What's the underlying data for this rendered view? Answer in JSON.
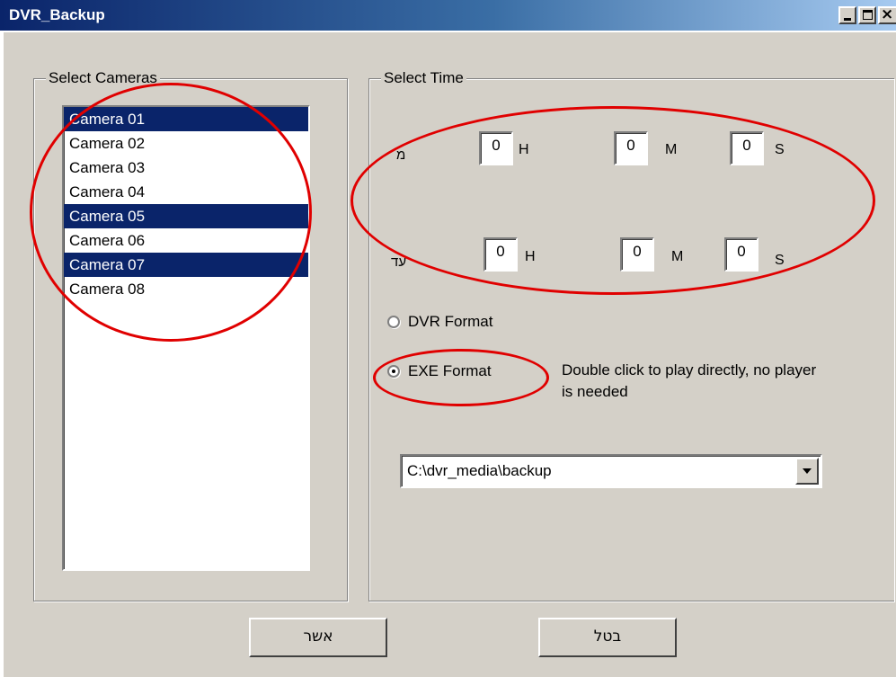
{
  "window": {
    "title": "DVR_Backup",
    "minimize_glyph": "",
    "maximize_glyph": "",
    "close_glyph": "×"
  },
  "cameras": {
    "legend": "Select Cameras",
    "items": [
      {
        "label": "Camera 01",
        "selected": true
      },
      {
        "label": "Camera 02",
        "selected": false
      },
      {
        "label": "Camera 03",
        "selected": false
      },
      {
        "label": "Camera 04",
        "selected": false
      },
      {
        "label": "Camera 05",
        "selected": true
      },
      {
        "label": "Camera 06",
        "selected": false
      },
      {
        "label": "Camera 07",
        "selected": true
      },
      {
        "label": "Camera 08",
        "selected": false
      }
    ]
  },
  "time": {
    "legend": "Select Time",
    "from_label": "מ",
    "to_label": "עד",
    "from": {
      "h": "0",
      "m": "0",
      "s": "0"
    },
    "to": {
      "h": "0",
      "m": "0",
      "s": "0"
    },
    "unit_h": "H",
    "unit_m": "M",
    "unit_s": "S"
  },
  "format": {
    "dvr_label": "DVR Format",
    "exe_label": "EXE Format",
    "selected": "exe",
    "exe_note": "Double click to play directly, no player is needed"
  },
  "path": {
    "value": "C:\\dvr_media\\backup"
  },
  "buttons": {
    "ok_label": "אשר",
    "cancel_label": "בטל"
  },
  "colors": {
    "selection": "#0a246a",
    "annotation": "#e00000",
    "face": "#d4d0c8"
  }
}
